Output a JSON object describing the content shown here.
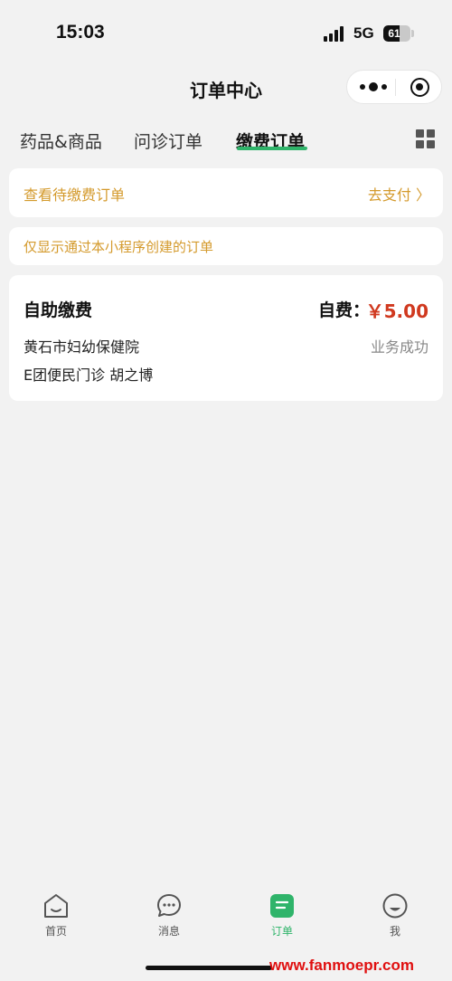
{
  "status_bar": {
    "time": "15:03",
    "network": "5G",
    "battery": "61",
    "battery_level_percent": 61
  },
  "nav": {
    "title": "订单中心"
  },
  "tabs": [
    {
      "label": "药品&商品",
      "active": false
    },
    {
      "label": "问诊订单",
      "active": false
    },
    {
      "label": "缴费订单",
      "active": true
    }
  ],
  "pending": {
    "text": "查看待缴费订单",
    "link": "去支付 〉"
  },
  "notice": {
    "text": "仅显示通过本小程序创建的订单"
  },
  "order": {
    "title": "自助缴费",
    "price_label": "自费：",
    "price": "￥5.00",
    "hospital": "黄石市妇幼保健院",
    "status": "业务成功",
    "doctor": "E团便民门诊  胡之博"
  },
  "tabbar": [
    {
      "label": "首页",
      "icon": "home-icon"
    },
    {
      "label": "消息",
      "icon": "message-icon"
    },
    {
      "label": "订单",
      "icon": "order-icon",
      "active": true
    },
    {
      "label": "我",
      "icon": "profile-icon"
    }
  ],
  "watermark": "www.fanmoepr.com",
  "colors": {
    "accent_green": "#2fb46a",
    "warning_orange": "#d49a2c",
    "price_red": "#d0391f"
  }
}
